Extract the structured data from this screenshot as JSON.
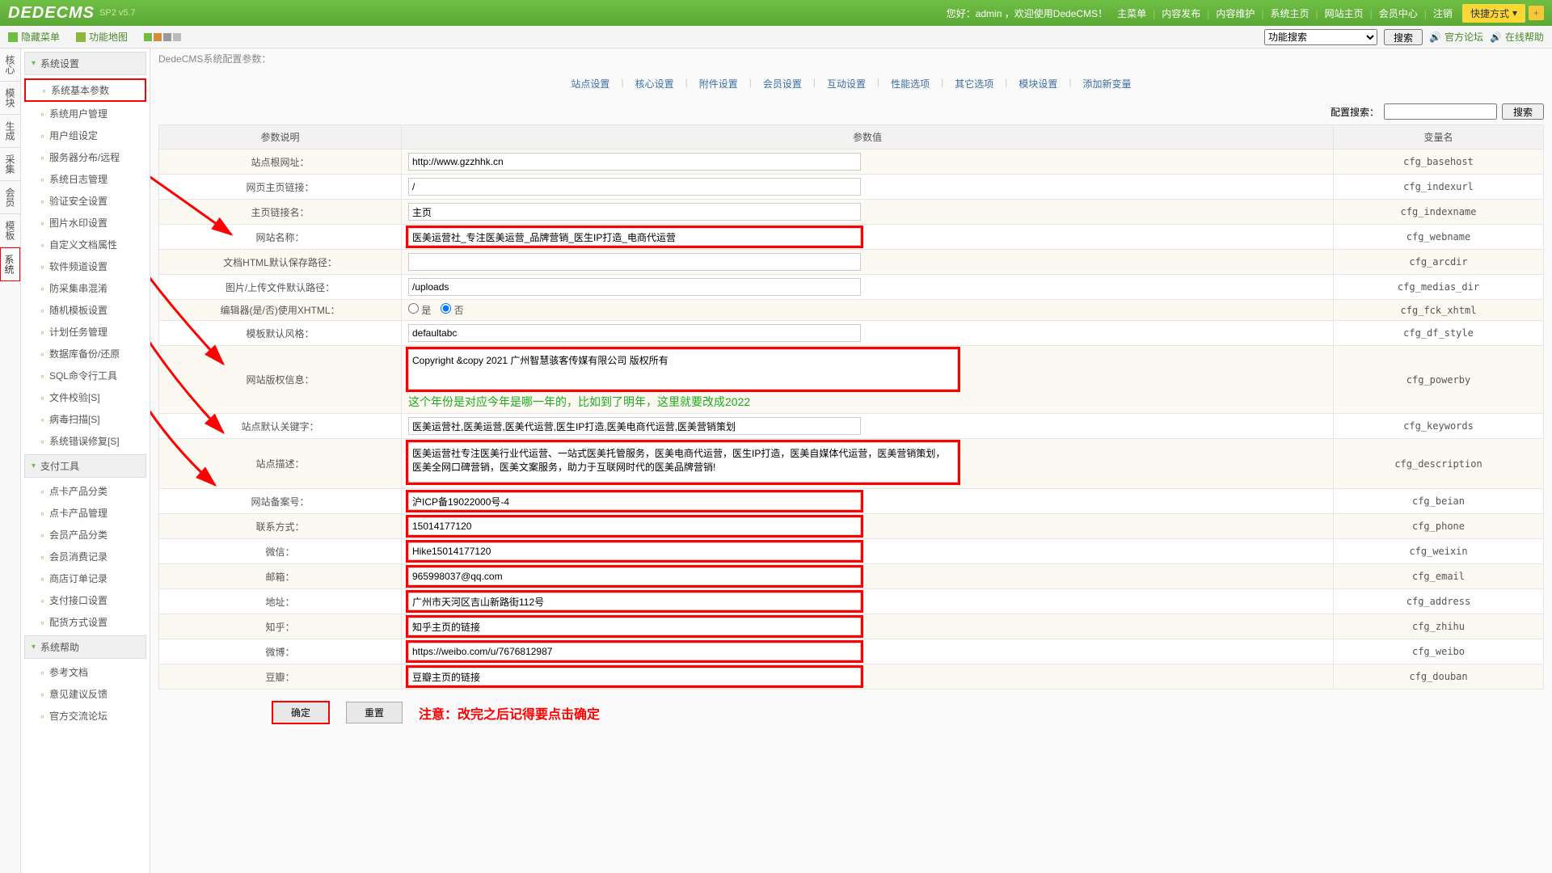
{
  "header": {
    "logo": "DEDECMS",
    "version": "SP2 v5.7",
    "welcome": "您好：admin ，欢迎使用DedeCMS！",
    "nav": [
      "主菜单",
      "内容发布",
      "内容维护",
      "系统主页",
      "网站主页",
      "会员中心",
      "注销"
    ],
    "quick": "快捷方式",
    "plus": "+"
  },
  "toolbar": {
    "hide_menu": "隐藏菜单",
    "sitemap": "功能地图",
    "search_placeholder": "功能搜索",
    "search_btn": "搜索",
    "forum": "官方论坛",
    "help": "在线帮助"
  },
  "vtabs": [
    "核心",
    "模块",
    "生成",
    "采集",
    "会员",
    "模板",
    "系统"
  ],
  "sidebar": {
    "groups": [
      {
        "title": "系统设置",
        "items": [
          "系统基本参数",
          "系统用户管理",
          "用户组设定",
          "服务器分布/远程",
          "系统日志管理",
          "验证安全设置",
          "图片水印设置",
          "自定义文档属性",
          "软件频道设置",
          "防采集串混淆",
          "随机模板设置",
          "计划任务管理",
          "数据库备份/还原",
          "SQL命令行工具",
          "文件校验[S]",
          "病毒扫描[S]",
          "系统错误修复[S]"
        ]
      },
      {
        "title": "支付工具",
        "items": [
          "点卡产品分类",
          "点卡产品管理",
          "会员产品分类",
          "会员消费记录",
          "商店订单记录",
          "支付接口设置",
          "配货方式设置"
        ]
      },
      {
        "title": "系统帮助",
        "items": [
          "参考文档",
          "意见建议反馈",
          "官方交流论坛"
        ]
      }
    ]
  },
  "main": {
    "crumb": "DedeCMS系统配置参数：",
    "tabs": [
      "站点设置",
      "核心设置",
      "附件设置",
      "会员设置",
      "互动设置",
      "性能选项",
      "其它选项",
      "模块设置",
      "添加新变量"
    ],
    "cfg_search_label": "配置搜索：",
    "cfg_search_btn": "搜索",
    "table_headers": {
      "name": "参数说明",
      "value": "参数值",
      "var": "变量名"
    },
    "rows": [
      {
        "name": "站点根网址：",
        "value": "http://www.gzzhhk.cn",
        "var": "cfg_basehost",
        "type": "text"
      },
      {
        "name": "网页主页链接：",
        "value": "/",
        "var": "cfg_indexurl",
        "type": "text"
      },
      {
        "name": "主页链接名：",
        "value": "主页",
        "var": "cfg_indexname",
        "type": "text"
      },
      {
        "name": "网站名称：",
        "value": "医美运营社_专注医美运营_品牌营销_医生IP打造_电商代运营",
        "var": "cfg_webname",
        "type": "text",
        "hl": true
      },
      {
        "name": "文档HTML默认保存路径：",
        "value": "",
        "var": "cfg_arcdir",
        "type": "text"
      },
      {
        "name": "图片/上传文件默认路径：",
        "value": "/uploads",
        "var": "cfg_medias_dir",
        "type": "text"
      },
      {
        "name": "编辑器(是/否)使用XHTML：",
        "value": "否",
        "var": "cfg_fck_xhtml",
        "type": "radio",
        "options": [
          "是",
          "否"
        ]
      },
      {
        "name": "模板默认风格：",
        "value": "defaultabc",
        "var": "cfg_df_style",
        "type": "text"
      },
      {
        "name": "网站版权信息：",
        "value": "Copyright &copy 2021 广州智慧骇客传媒有限公司 版权所有",
        "var": "cfg_powerby",
        "type": "textarea",
        "hl": true,
        "annotation": "这个年份是对应今年是哪一年的，比如到了明年，这里就要改成2022"
      },
      {
        "name": "站点默认关键字：",
        "value": "医美运营社,医美运营,医美代运营,医生IP打造,医美电商代运营,医美营销策划",
        "var": "cfg_keywords",
        "type": "text"
      },
      {
        "name": "站点描述：",
        "value": "医美运营社专注医美行业代运营、一站式医美托管服务，医美电商代运营，医生IP打造，医美自媒体代运营，医美营销策划，医美全网口碑营销，医美文案服务，助力于互联网时代的医美品牌营销!",
        "var": "cfg_description",
        "type": "textarea",
        "hl": true
      },
      {
        "name": "网站备案号：",
        "value": "沪ICP备19022000号-4",
        "var": "cfg_beian",
        "type": "text",
        "hl": true
      },
      {
        "name": "联系方式：",
        "value": "15014177120",
        "var": "cfg_phone",
        "type": "text",
        "hl": true
      },
      {
        "name": "微信：",
        "value": "Hike15014177120",
        "var": "cfg_weixin",
        "type": "text",
        "hl": true
      },
      {
        "name": "邮箱：",
        "value": "965998037@qq.com",
        "var": "cfg_email",
        "type": "text",
        "hl": true
      },
      {
        "name": "地址：",
        "value": "广州市天河区吉山新路街112号",
        "var": "cfg_address",
        "type": "text",
        "hl": true
      },
      {
        "name": "知乎：",
        "value": "知乎主页的链接",
        "var": "cfg_zhihu",
        "type": "text",
        "hl": true
      },
      {
        "name": "微博：",
        "value": "https://weibo.com/u/7676812987",
        "var": "cfg_weibo",
        "type": "text",
        "hl": true
      },
      {
        "name": "豆瓣：",
        "value": "豆瓣主页的链接",
        "var": "cfg_douban",
        "type": "text",
        "hl": true
      }
    ],
    "submit": "确定",
    "reset": "重置",
    "note": "注意：改完之后记得要点击确定"
  }
}
